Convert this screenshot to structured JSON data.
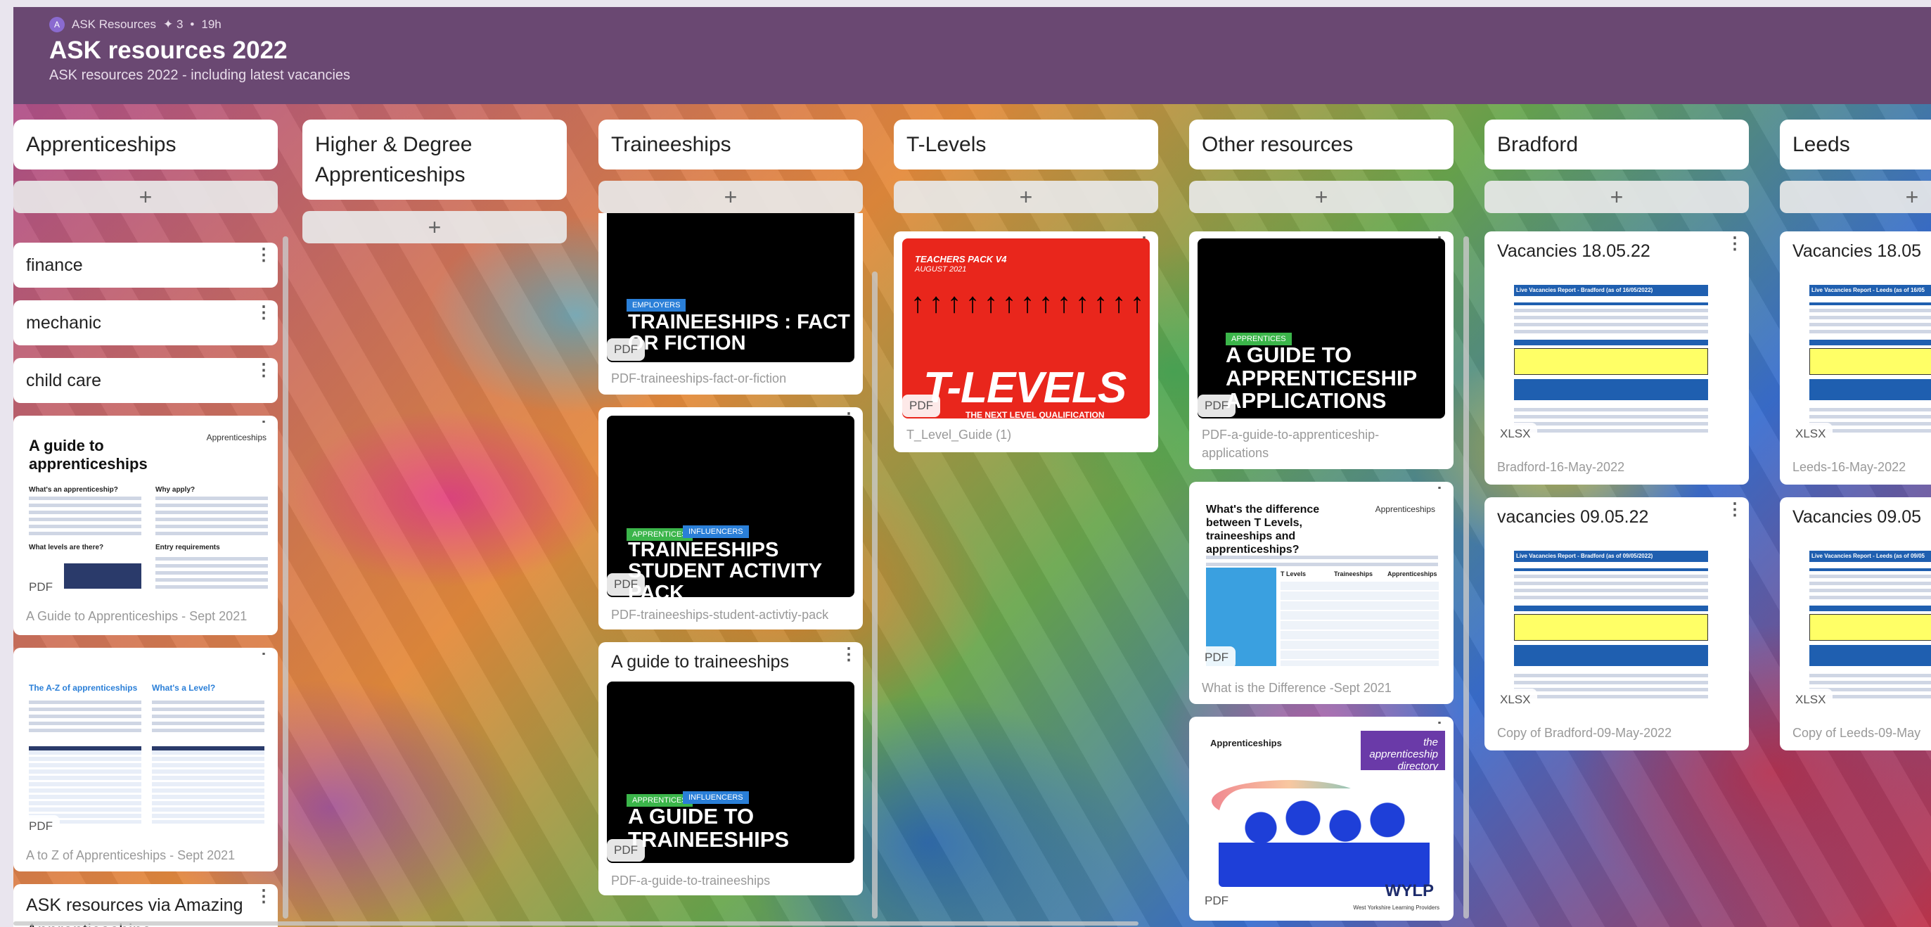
{
  "header": {
    "avatar": "A",
    "workspace": "ASK Resources",
    "likes": "✦ 3",
    "dot": "•",
    "age": "19h",
    "title": "ASK resources 2022",
    "subtitle": "ASK resources 2022 - including latest vacancies"
  },
  "add_label": "+",
  "menu": "⋮",
  "columns": {
    "apprenticeships": {
      "title": "Apprenticeships",
      "cards": [
        {
          "title": "finance"
        },
        {
          "title": "mechanic"
        },
        {
          "title": "child care"
        },
        {
          "badge": "PDF",
          "caption": "A Guide to Apprenticeships - Sept 2021",
          "thumb": {
            "h1": "A guide to",
            "h2": "apprenticeships",
            "logo": "Apprenticeships",
            "q1": "What's an apprenticeship?",
            "q2": "Why apply?",
            "q3": "What levels are there?",
            "q4": "Entry requirements"
          }
        },
        {
          "badge": "PDF",
          "caption": "A to Z of Apprenticeships - Sept 2021",
          "thumb": {
            "h1": "The A-Z of apprenticeships",
            "h2": "What's a Level?"
          }
        },
        {
          "title": "ASK resources via Amazing Apprenticeships"
        }
      ]
    },
    "higher": {
      "title": "Higher & Degree Apprenticeships"
    },
    "traineeships": {
      "title": "Traineeships",
      "cards": [
        {
          "badge": "PDF",
          "caption": "PDF-traineeships-fact-or-fiction",
          "tag": "EMPLOYERS",
          "big": "TRAINEESHIPS : FACT OR FICTION"
        },
        {
          "badge": "PDF",
          "caption": "PDF-traineeships-student-activtiy-pack",
          "tag1": "APPRENTICES",
          "tag2": "INFLUENCERS",
          "big": "TRAINEESHIPS STUDENT ACTIVITY PACK"
        },
        {
          "title": "A guide to traineeships",
          "badge": "PDF",
          "caption": "PDF-a-guide-to-traineeships",
          "tag1": "APPRENTICES",
          "tag2": "INFLUENCERS",
          "big": "A GUIDE TO TRAINEESHIPS"
        }
      ]
    },
    "tlevels": {
      "title": "T-Levels",
      "cards": [
        {
          "badge": "PDF",
          "caption": "T_Level_Guide (1)",
          "pack": "TEACHERS PACK V4",
          "date": "AUGUST 2021",
          "big": "T-LEVELS",
          "strap": "THE NEXT LEVEL QUALIFICATION"
        }
      ]
    },
    "other": {
      "title": "Other resources",
      "cards": [
        {
          "badge": "PDF",
          "caption": "PDF-a-guide-to-apprenticeship-applications",
          "tag": "APPRENTICES",
          "big": "A GUIDE TO APPRENTICESHIP APPLICATIONS"
        },
        {
          "badge": "PDF",
          "caption": "What is the Difference -Sept 2021",
          "thumb": {
            "h": "What's the difference between T Levels, traineeships and apprenticeships?",
            "logo": "Apprenticeships",
            "c1": "T Levels",
            "c2": "Traineeships",
            "c3": "Apprenticeships"
          }
        },
        {
          "badge": "PDF",
          "thumb": {
            "logo": "Apprenticeships",
            "dir": "the apprenticeship directory",
            "wylp": "WYLP",
            "wylp_sub": "West Yorkshire Learning Providers"
          }
        }
      ]
    },
    "bradford": {
      "title": "Bradford",
      "cards": [
        {
          "title": "Vacancies 18.05.22",
          "badge": "XLSX",
          "caption": "Bradford-16-May-2022",
          "report": "Live Vacancies Report - Bradford (as of 16/05/2022)"
        },
        {
          "title": "vacancies 09.05.22",
          "badge": "XLSX",
          "caption": "Copy of Bradford-09-May-2022",
          "report": "Live Vacancies Report - Bradford (as of 09/05/2022)"
        }
      ]
    },
    "leeds": {
      "title": "Leeds",
      "cards": [
        {
          "title": "Vacancies 18.05",
          "badge": "XLSX",
          "caption": "Leeds-16-May-2022",
          "report": "Live Vacancies Report - Leeds (as of 16/05"
        },
        {
          "title": "Vacancies 09.05",
          "badge": "XLSX",
          "caption": "Copy of Leeds-09-May",
          "report": "Live Vacancies Report - Leeds (as of 09/05"
        }
      ]
    }
  },
  "colors": {
    "header": "#6a4872",
    "tlevel_red": "#e9261c",
    "report_blue": "#1f5fb0",
    "tag_green": "#3bb54a",
    "tag_blue": "#2a7fd8"
  }
}
